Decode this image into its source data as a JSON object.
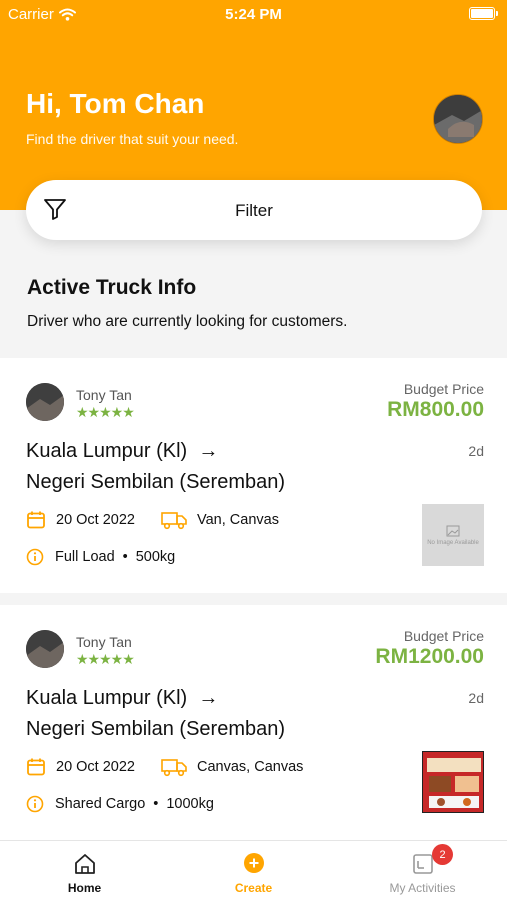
{
  "status_bar": {
    "carrier": "Carrier",
    "time": "5:24 PM"
  },
  "header": {
    "greeting": "Hi, Tom Chan",
    "subtitle": "Find the driver that suit your need."
  },
  "filter": {
    "label": "Filter",
    "icon": "filter-icon"
  },
  "section": {
    "title": "Active Truck Info",
    "subtitle": "Driver who are currently looking for customers."
  },
  "cards": [
    {
      "driver": "Tony Tan",
      "rating_stars": "★★★★★",
      "budget_label": "Budget Price",
      "price": "RM800.00",
      "from": "Kuala Lumpur (Kl)",
      "arrow": "→",
      "to": "Negeri Sembilan (Seremban)",
      "age": "2d",
      "date": "20 Oct 2022",
      "vehicle": "Van, Canvas",
      "load_type": "Full Load",
      "weight": "500kg",
      "thumb_text": "No Image Available"
    },
    {
      "driver": "Tony Tan",
      "rating_stars": "★★★★★",
      "budget_label": "Budget Price",
      "price": "RM1200.00",
      "from": "Kuala Lumpur (Kl)",
      "arrow": "→",
      "to": "Negeri Sembilan (Seremban)",
      "age": "2d",
      "date": "20 Oct 2022",
      "vehicle": "Canvas, Canvas",
      "load_type": "Shared Cargo",
      "weight": "1000kg"
    }
  ],
  "tabbar": {
    "home": "Home",
    "create": "Create",
    "activities": "My Activities",
    "activities_badge": "2"
  },
  "colors": {
    "brand": "#ffa500",
    "price_green": "#7cb342",
    "badge_red": "#e53935"
  }
}
